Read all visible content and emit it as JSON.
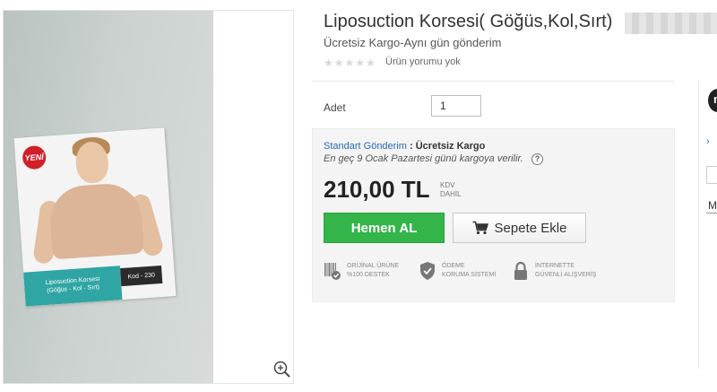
{
  "product": {
    "title": "Liposuction Korsesi( Göğüs,Kol,Sırt)",
    "subtitle": "Ücretsiz Kargo-Aynı gün gönderim",
    "rating_stars": "★★★★★",
    "rating_value": 0,
    "review_label": "Ürün yorumu yok"
  },
  "image": {
    "badge": "YENİ",
    "flyer_line1": "Liposuction Korsesi",
    "flyer_line2": "(Göğüs - Kol - Sırt)",
    "flyer_code": "Kod - 230",
    "zoom_icon": "zoom-in-icon"
  },
  "quantity": {
    "label": "Adet",
    "value": "1"
  },
  "shipping": {
    "method": "Standart Gönderim",
    "separator": ":",
    "cost": "Ücretsiz Kargo",
    "delivery_note": "En geç 9 Ocak Pazartesi günü kargoya verilir.",
    "help": "?"
  },
  "price": {
    "amount": "210,00 TL",
    "tax_line1": "KDV",
    "tax_line2": "DAHİL"
  },
  "actions": {
    "buy_now": "Hemen AL",
    "add_to_cart": "Sepete Ekle"
  },
  "trust_badges": [
    {
      "icon": "barcode-check-icon",
      "line1": "ORİJİNAL ÜRÜNE",
      "line2": "%100 DESTEK"
    },
    {
      "icon": "shield-check-icon",
      "line1": "ÖDEME",
      "line2": "KORUMA SİSTEMİ"
    },
    {
      "icon": "lock-icon",
      "line1": "İNTERNETTE",
      "line2": "GÜVENLİ ALIŞVERİŞ"
    }
  ],
  "side_panel": {
    "avatar": "n",
    "chevron": "›",
    "tab": "M"
  },
  "colors": {
    "buy_button": "#33b54a",
    "link": "#2a6ab8",
    "buy_box_bg": "#f4f4f4"
  }
}
